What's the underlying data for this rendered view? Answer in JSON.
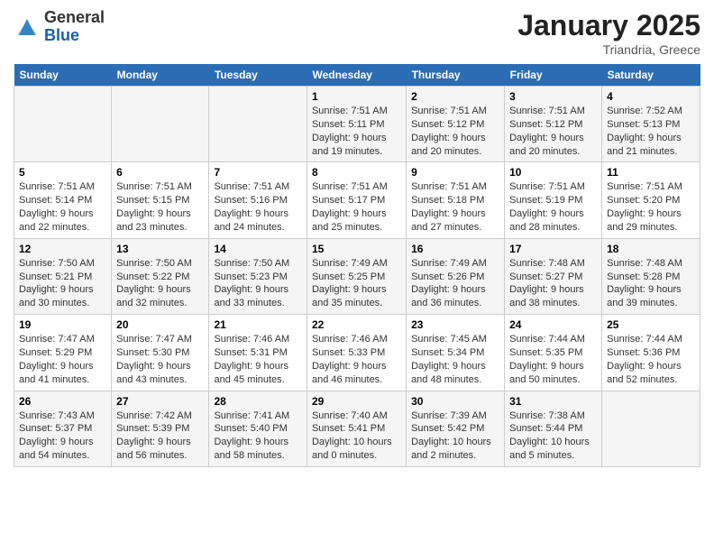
{
  "header": {
    "logo_general": "General",
    "logo_blue": "Blue",
    "month": "January 2025",
    "location": "Triandria, Greece"
  },
  "weekdays": [
    "Sunday",
    "Monday",
    "Tuesday",
    "Wednesday",
    "Thursday",
    "Friday",
    "Saturday"
  ],
  "weeks": [
    [
      {
        "day": "",
        "info": ""
      },
      {
        "day": "",
        "info": ""
      },
      {
        "day": "",
        "info": ""
      },
      {
        "day": "1",
        "info": "Sunrise: 7:51 AM\nSunset: 5:11 PM\nDaylight: 9 hours\nand 19 minutes."
      },
      {
        "day": "2",
        "info": "Sunrise: 7:51 AM\nSunset: 5:12 PM\nDaylight: 9 hours\nand 20 minutes."
      },
      {
        "day": "3",
        "info": "Sunrise: 7:51 AM\nSunset: 5:12 PM\nDaylight: 9 hours\nand 20 minutes."
      },
      {
        "day": "4",
        "info": "Sunrise: 7:52 AM\nSunset: 5:13 PM\nDaylight: 9 hours\nand 21 minutes."
      }
    ],
    [
      {
        "day": "5",
        "info": "Sunrise: 7:51 AM\nSunset: 5:14 PM\nDaylight: 9 hours\nand 22 minutes."
      },
      {
        "day": "6",
        "info": "Sunrise: 7:51 AM\nSunset: 5:15 PM\nDaylight: 9 hours\nand 23 minutes."
      },
      {
        "day": "7",
        "info": "Sunrise: 7:51 AM\nSunset: 5:16 PM\nDaylight: 9 hours\nand 24 minutes."
      },
      {
        "day": "8",
        "info": "Sunrise: 7:51 AM\nSunset: 5:17 PM\nDaylight: 9 hours\nand 25 minutes."
      },
      {
        "day": "9",
        "info": "Sunrise: 7:51 AM\nSunset: 5:18 PM\nDaylight: 9 hours\nand 27 minutes."
      },
      {
        "day": "10",
        "info": "Sunrise: 7:51 AM\nSunset: 5:19 PM\nDaylight: 9 hours\nand 28 minutes."
      },
      {
        "day": "11",
        "info": "Sunrise: 7:51 AM\nSunset: 5:20 PM\nDaylight: 9 hours\nand 29 minutes."
      }
    ],
    [
      {
        "day": "12",
        "info": "Sunrise: 7:50 AM\nSunset: 5:21 PM\nDaylight: 9 hours\nand 30 minutes."
      },
      {
        "day": "13",
        "info": "Sunrise: 7:50 AM\nSunset: 5:22 PM\nDaylight: 9 hours\nand 32 minutes."
      },
      {
        "day": "14",
        "info": "Sunrise: 7:50 AM\nSunset: 5:23 PM\nDaylight: 9 hours\nand 33 minutes."
      },
      {
        "day": "15",
        "info": "Sunrise: 7:49 AM\nSunset: 5:25 PM\nDaylight: 9 hours\nand 35 minutes."
      },
      {
        "day": "16",
        "info": "Sunrise: 7:49 AM\nSunset: 5:26 PM\nDaylight: 9 hours\nand 36 minutes."
      },
      {
        "day": "17",
        "info": "Sunrise: 7:48 AM\nSunset: 5:27 PM\nDaylight: 9 hours\nand 38 minutes."
      },
      {
        "day": "18",
        "info": "Sunrise: 7:48 AM\nSunset: 5:28 PM\nDaylight: 9 hours\nand 39 minutes."
      }
    ],
    [
      {
        "day": "19",
        "info": "Sunrise: 7:47 AM\nSunset: 5:29 PM\nDaylight: 9 hours\nand 41 minutes."
      },
      {
        "day": "20",
        "info": "Sunrise: 7:47 AM\nSunset: 5:30 PM\nDaylight: 9 hours\nand 43 minutes."
      },
      {
        "day": "21",
        "info": "Sunrise: 7:46 AM\nSunset: 5:31 PM\nDaylight: 9 hours\nand 45 minutes."
      },
      {
        "day": "22",
        "info": "Sunrise: 7:46 AM\nSunset: 5:33 PM\nDaylight: 9 hours\nand 46 minutes."
      },
      {
        "day": "23",
        "info": "Sunrise: 7:45 AM\nSunset: 5:34 PM\nDaylight: 9 hours\nand 48 minutes."
      },
      {
        "day": "24",
        "info": "Sunrise: 7:44 AM\nSunset: 5:35 PM\nDaylight: 9 hours\nand 50 minutes."
      },
      {
        "day": "25",
        "info": "Sunrise: 7:44 AM\nSunset: 5:36 PM\nDaylight: 9 hours\nand 52 minutes."
      }
    ],
    [
      {
        "day": "26",
        "info": "Sunrise: 7:43 AM\nSunset: 5:37 PM\nDaylight: 9 hours\nand 54 minutes."
      },
      {
        "day": "27",
        "info": "Sunrise: 7:42 AM\nSunset: 5:39 PM\nDaylight: 9 hours\nand 56 minutes."
      },
      {
        "day": "28",
        "info": "Sunrise: 7:41 AM\nSunset: 5:40 PM\nDaylight: 9 hours\nand 58 minutes."
      },
      {
        "day": "29",
        "info": "Sunrise: 7:40 AM\nSunset: 5:41 PM\nDaylight: 10 hours\nand 0 minutes."
      },
      {
        "day": "30",
        "info": "Sunrise: 7:39 AM\nSunset: 5:42 PM\nDaylight: 10 hours\nand 2 minutes."
      },
      {
        "day": "31",
        "info": "Sunrise: 7:38 AM\nSunset: 5:44 PM\nDaylight: 10 hours\nand 5 minutes."
      },
      {
        "day": "",
        "info": ""
      }
    ]
  ]
}
